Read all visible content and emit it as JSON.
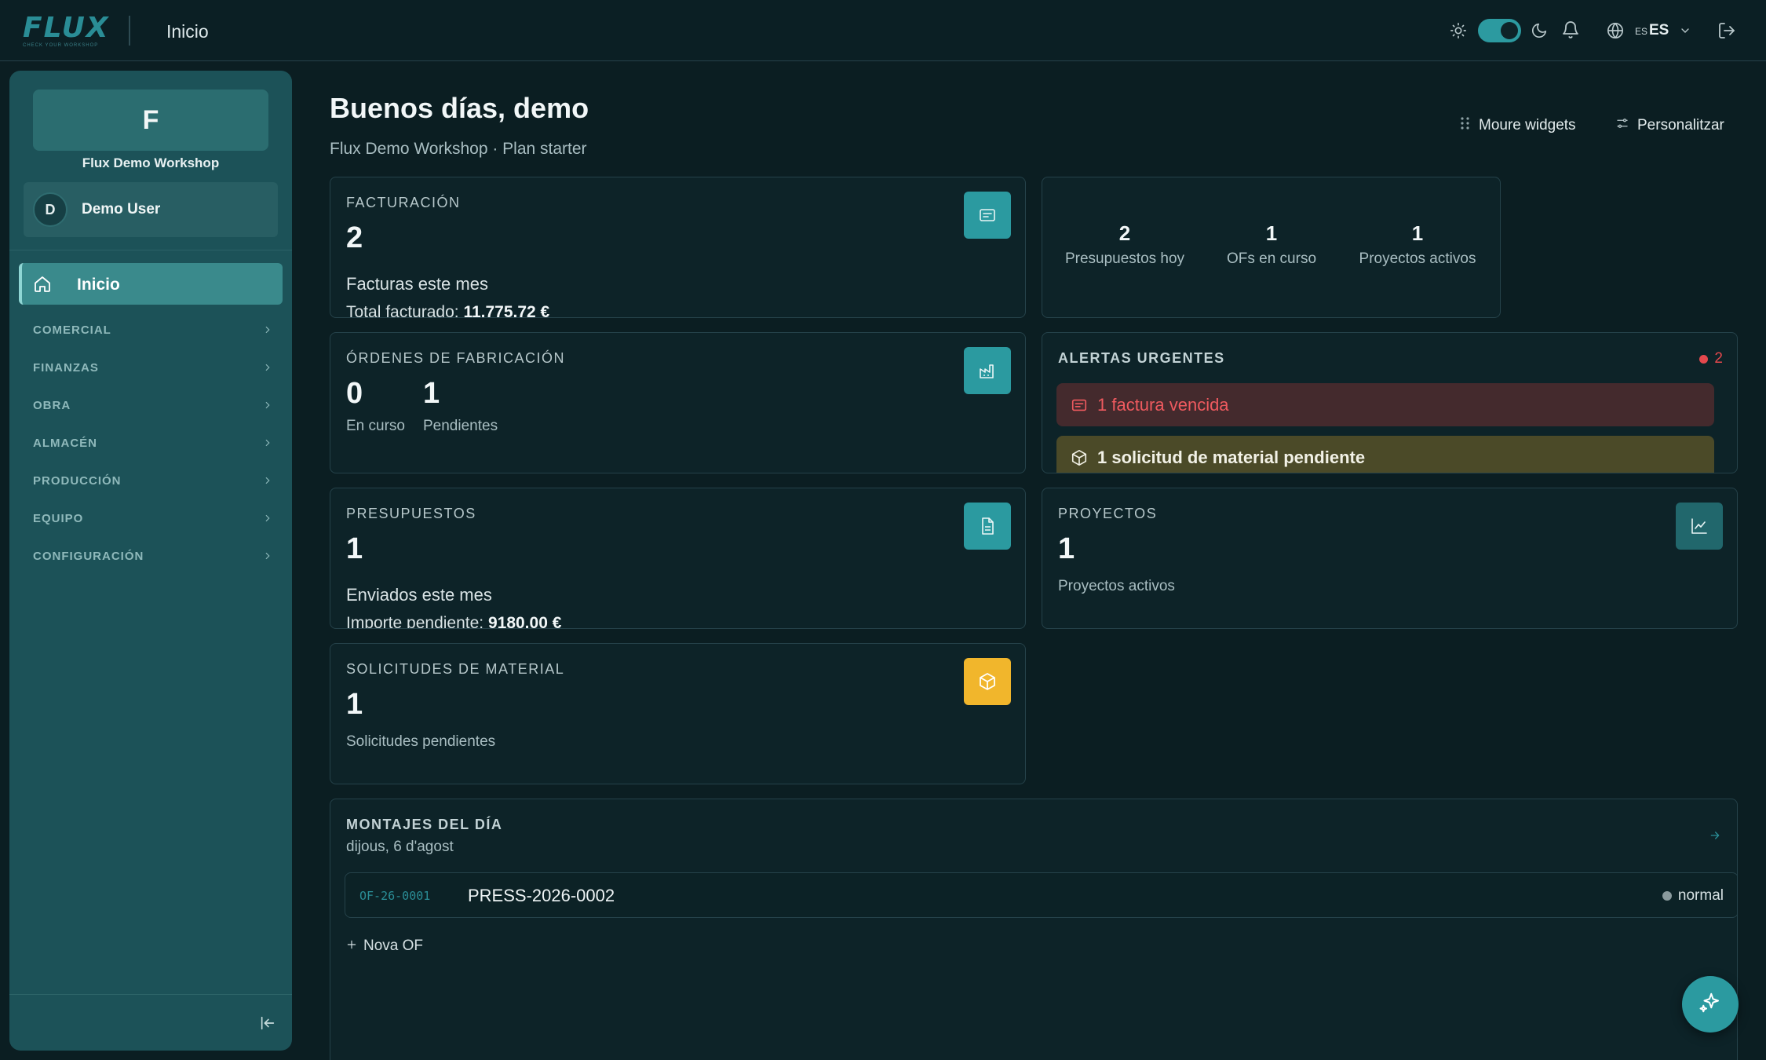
{
  "topbar": {
    "logo_text": "FLUX",
    "logo_tagline": "CHECK YOUR WORKSHOP",
    "page_title": "Inicio",
    "language_flag": "ES",
    "language_code": "ES"
  },
  "sidebar": {
    "org_initial": "F",
    "org_name": "Flux Demo Workshop",
    "user_initial": "D",
    "user_name": "Demo User",
    "active_item": "Inicio",
    "sections": [
      "COMERCIAL",
      "FINANZAS",
      "OBRA",
      "ALMACÉN",
      "PRODUCCIÓN",
      "EQUIPO",
      "CONFIGURACIÓN"
    ]
  },
  "header": {
    "greeting": "Buenos días, demo",
    "subtitle": "Flux Demo Workshop · Plan starter",
    "move_widgets": "Moure widgets",
    "customize": "Personalitzar"
  },
  "facturacion": {
    "title": "FACTURACIÓN",
    "value": "2",
    "desc": "Facturas este mes",
    "total_label": "Total facturado:",
    "total_value": "11.775.72 €"
  },
  "summary": {
    "stats": [
      {
        "value": "2",
        "label": "Presupuestos hoy"
      },
      {
        "value": "1",
        "label": "OFs en curso"
      },
      {
        "value": "1",
        "label": "Proyectos activos"
      }
    ]
  },
  "ordenes": {
    "title": "ÓRDENES DE FABRICACIÓN",
    "in_progress_value": "0",
    "in_progress_label": "En curso",
    "pending_value": "1",
    "pending_label": "Pendientes"
  },
  "alertas": {
    "title": "ALERTAS URGENTES",
    "count": "2",
    "items": [
      "1 factura vencida",
      "1 solicitud de material pendiente"
    ]
  },
  "presupuestos": {
    "title": "PRESUPUESTOS",
    "value": "1",
    "desc": "Enviados este mes",
    "pending_label": "Importe pendiente:",
    "pending_value": "9180.00 €"
  },
  "proyectos": {
    "title": "PROYECTOS",
    "value": "1",
    "desc": "Proyectos activos"
  },
  "solicitudes": {
    "title": "SOLICITUDES DE MATERIAL",
    "value": "1",
    "desc": "Solicitudes pendientes"
  },
  "montajes": {
    "title": "MONTAJES DEL DÍA",
    "date": "dijous, 6 d'agost",
    "rows": [
      {
        "code": "OF-26-0001",
        "name": "PRESS-2026-0002",
        "priority": "normal"
      }
    ],
    "new_label": "Nova OF"
  },
  "colors": {
    "accent": "#2b9aa0",
    "warning": "#f1b62c",
    "danger": "#e5484d",
    "sidebar": "#1c5258",
    "background": "#0b1e22"
  }
}
